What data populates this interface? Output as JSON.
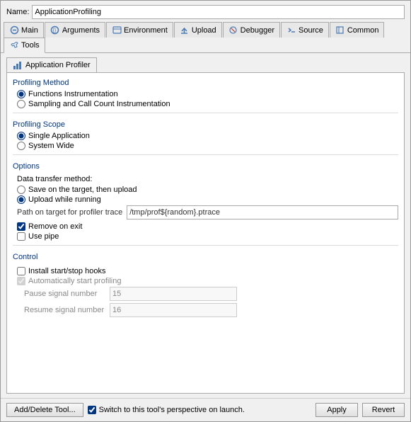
{
  "dialog": {
    "name_label": "Name:",
    "name_value": "ApplicationProfiling"
  },
  "tabs": [
    {
      "label": "Main",
      "icon": "main-icon"
    },
    {
      "label": "Arguments",
      "icon": "arguments-icon"
    },
    {
      "label": "Environment",
      "icon": "environment-icon"
    },
    {
      "label": "Upload",
      "icon": "upload-icon"
    },
    {
      "label": "Debugger",
      "icon": "debugger-icon"
    },
    {
      "label": "Source",
      "icon": "source-icon"
    },
    {
      "label": "Common",
      "icon": "common-icon"
    },
    {
      "label": "Tools",
      "icon": "tools-icon"
    }
  ],
  "inner_tab": {
    "label": "Application Profiler",
    "icon": "profiler-icon"
  },
  "profiling_method": {
    "section_label": "Profiling Method",
    "options": [
      {
        "label": "Functions Instrumentation",
        "selected": true
      },
      {
        "label": "Sampling and Call Count Instrumentation",
        "selected": false
      }
    ]
  },
  "profiling_scope": {
    "section_label": "Profiling Scope",
    "options": [
      {
        "label": "Single Application",
        "selected": true
      },
      {
        "label": "System Wide",
        "selected": false
      }
    ]
  },
  "options": {
    "section_label": "Options",
    "data_transfer_label": "Data transfer method:",
    "transfer_options": [
      {
        "label": "Save on the target, then upload",
        "selected": false
      },
      {
        "label": "Upload while running",
        "selected": true
      }
    ],
    "path_label": "Path on target for profiler trace",
    "path_value": "/tmp/prof${random}.ptrace",
    "checkboxes": [
      {
        "label": "Remove on exit",
        "checked": true
      },
      {
        "label": "Use pipe",
        "checked": false
      }
    ]
  },
  "control": {
    "section_label": "Control",
    "install_hooks": {
      "label": "Install start/stop hooks",
      "checked": false
    },
    "auto_start": {
      "label": "Automatically start profiling",
      "checked": true,
      "disabled": true
    },
    "pause_signal": {
      "label": "Pause signal number",
      "value": "15",
      "disabled": true
    },
    "resume_signal": {
      "label": "Resume signal number",
      "value": "16",
      "disabled": true
    }
  },
  "footer": {
    "add_delete_label": "Add/Delete Tool...",
    "switch_label": "Switch to this tool's perspective on launch.",
    "switch_checked": true,
    "apply_label": "Apply",
    "revert_label": "Revert"
  }
}
